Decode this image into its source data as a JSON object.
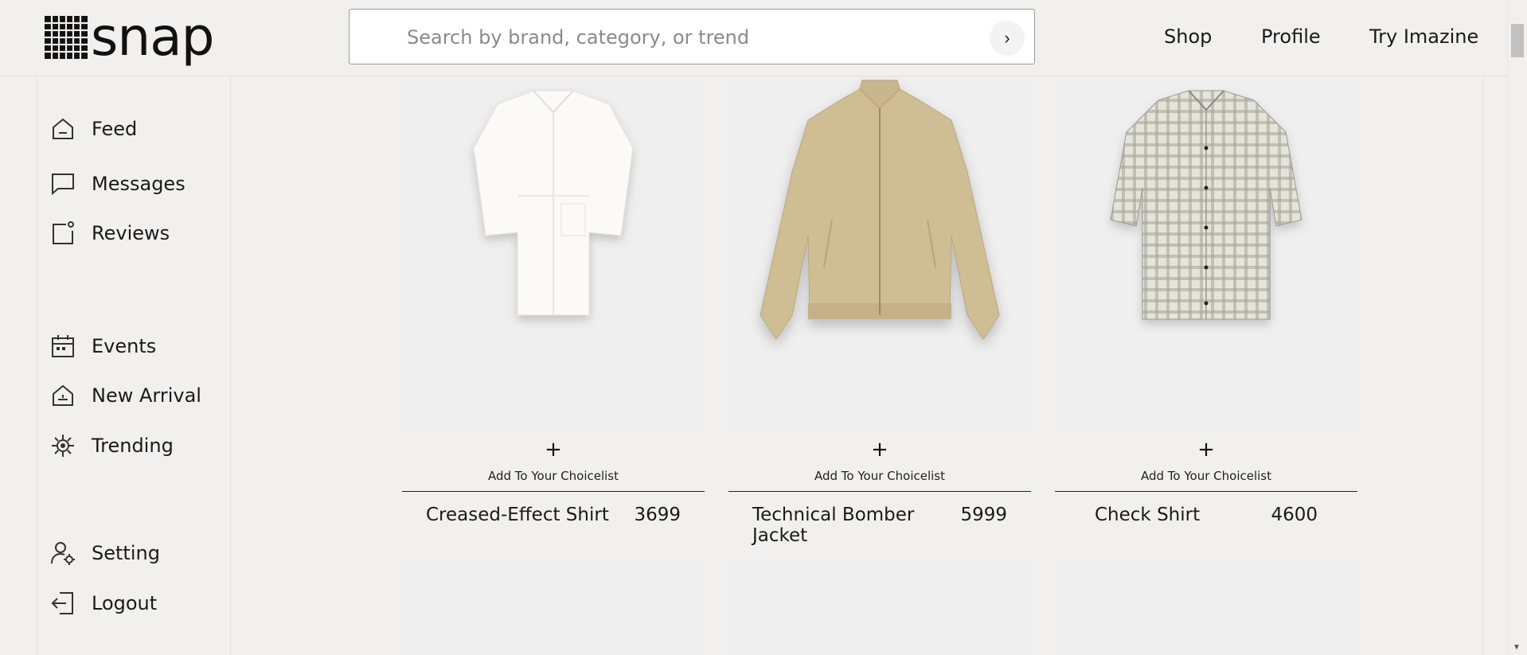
{
  "brand": {
    "name": "snap"
  },
  "search": {
    "placeholder": "Search by brand, category, or trend",
    "submit_icon": "chevron-right-icon"
  },
  "topnav": [
    {
      "label": "Shop"
    },
    {
      "label": "Profile"
    },
    {
      "label": "Try Imazine"
    }
  ],
  "sidebar": {
    "items": [
      {
        "label": "Feed",
        "icon": "home-icon"
      },
      {
        "label": "Messages",
        "icon": "message-icon"
      },
      {
        "label": "Reviews",
        "icon": "reviews-icon"
      },
      {
        "label": "Events",
        "icon": "calendar-icon"
      },
      {
        "label": "New Arrival",
        "icon": "bag-icon"
      },
      {
        "label": "Trending",
        "icon": "trending-icon"
      },
      {
        "label": "Setting",
        "icon": "user-settings-icon"
      },
      {
        "label": "Logout",
        "icon": "logout-icon"
      }
    ]
  },
  "products": [
    {
      "name": "Creased-Effect Shirt",
      "price": "3699",
      "add_label": "Add To Your Choicelist",
      "plus": "+",
      "color": "#fbfaf6"
    },
    {
      "name": "Technical Bomber Jacket",
      "price": "5999",
      "add_label": "Add To Your Choicelist",
      "plus": "+",
      "color": "#cfbd94"
    },
    {
      "name": "Check Shirt",
      "price": "4600",
      "add_label": "Add To Your Choicelist",
      "plus": "+",
      "color": "#c9c8bc"
    }
  ]
}
